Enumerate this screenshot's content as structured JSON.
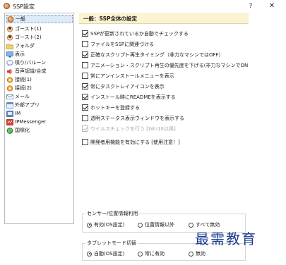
{
  "window": {
    "title": "SSP設定",
    "help_label": "?",
    "close_label": "✕"
  },
  "sidebar": {
    "items": [
      {
        "label": "一般",
        "icon": "ssp-app-icon",
        "selected": true
      },
      {
        "label": "ゴースト(1)",
        "icon": "ghost-icon",
        "selected": false
      },
      {
        "label": "ゴースト(2)",
        "icon": "ghost-icon",
        "selected": false
      },
      {
        "label": "フォルダ",
        "icon": "folder-icon",
        "selected": false
      },
      {
        "label": "表示",
        "icon": "display-icon",
        "selected": false
      },
      {
        "label": "喋り/バルーン",
        "icon": "balloon-icon",
        "selected": false
      },
      {
        "label": "音声認識/合成",
        "icon": "speaker-icon",
        "selected": false
      },
      {
        "label": "接続(1)",
        "icon": "connection-icon",
        "selected": false
      },
      {
        "label": "接続(2)",
        "icon": "connection-icon",
        "selected": false
      },
      {
        "label": "メール",
        "icon": "mail-icon",
        "selected": false
      },
      {
        "label": "外部アプリ",
        "icon": "external-app-icon",
        "selected": false
      },
      {
        "label": "IM",
        "icon": "im-icon",
        "selected": false
      },
      {
        "label": "IPMessenger",
        "icon": "ipmessenger-icon",
        "selected": false
      },
      {
        "label": "国際化",
        "icon": "globe-icon",
        "selected": false
      }
    ]
  },
  "panel": {
    "header": "一般：SSP全体の設定",
    "options": [
      {
        "label": "SSPが更新されているか自動でチェックする",
        "checked": true,
        "enabled": true
      },
      {
        "label": "ファイルをSSPに関連づける",
        "checked": false,
        "enabled": true
      },
      {
        "label": "正確なスクリプト再生タイミング（非力なマシンではOFF）",
        "checked": true,
        "enabled": true
      },
      {
        "label": "アニメーション・スクリプト再生の優先度を下げる(非力なマシンでON",
        "checked": false,
        "enabled": true
      },
      {
        "label": "常にアンインストールメニューを表示",
        "checked": false,
        "enabled": true
      },
      {
        "label": "常にタスクトレイアイコンを表示",
        "checked": true,
        "enabled": true
      },
      {
        "label": "インストール時にREADMEを表示する",
        "checked": true,
        "enabled": true
      },
      {
        "label": "ホットキーを登録する",
        "checked": true,
        "enabled": true
      },
      {
        "label": "透明ステータス表示ウィンドウを表示する",
        "checked": false,
        "enabled": true
      },
      {
        "label": "ウイルスチェックを行う [Win10以降]",
        "checked": true,
        "enabled": false
      },
      {
        "label": "開発者用機能を有効にする [使用注意！]",
        "checked": false,
        "enabled": true
      }
    ],
    "sensor_group": {
      "title": "センサー/位置情報利用",
      "options": [
        {
          "label": "有効(OS設定)",
          "selected": true
        },
        {
          "label": "位置情報以外",
          "selected": false
        },
        {
          "label": "すべて無効",
          "selected": false
        }
      ]
    },
    "tablet_group": {
      "title": "タブレットモード切替",
      "options": [
        {
          "label": "自動(OS設定)",
          "selected": true
        },
        {
          "label": "常に有効",
          "selected": false
        },
        {
          "label": "無効",
          "selected": false
        }
      ]
    }
  },
  "watermark": "最需教育"
}
